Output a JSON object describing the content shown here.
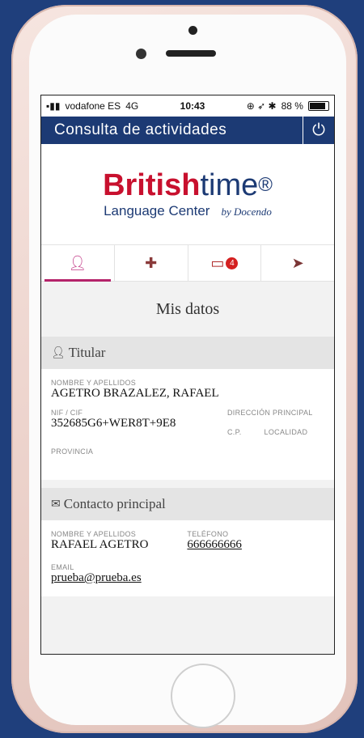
{
  "status_bar": {
    "carrier": "vodafone ES",
    "network": "4G",
    "time": "10:43",
    "battery": "88 %"
  },
  "header": {
    "title": "Consulta de actividades",
    "power_icon": "power-icon"
  },
  "logo": {
    "british": "British",
    "time": "time",
    "registered": "®",
    "subtitle": "Language Center",
    "by": "by Docendo"
  },
  "tabs": [
    {
      "icon": "user-icon",
      "active": true
    },
    {
      "icon": "puzzle-icon",
      "active": false
    },
    {
      "icon": "card-icon",
      "active": false,
      "badge": "4"
    },
    {
      "icon": "send-icon",
      "active": false
    }
  ],
  "main": {
    "section_title": "Mis datos",
    "titular": {
      "heading": "Titular",
      "name_label": "NOMBRE Y APELLIDOS",
      "name_value": "AGETRO BRAZALEZ, RAFAEL",
      "nif_label": "NIF / CIF",
      "nif_value": "352685G6+WER8T+9E8",
      "address_label": "DIRECCIÓN PRINCIPAL",
      "cp_label": "C.P.",
      "locality_label": "LOCALIDAD",
      "province_label": "PROVINCIA"
    },
    "contacto": {
      "heading": "Contacto principal",
      "name_label": "NOMBRE Y APELLIDOS",
      "name_value": "RAFAEL AGETRO",
      "phone_label": "TELÉFONO",
      "phone_value": "666666666",
      "email_label": "EMAIL",
      "email_value": "prueba@prueba.es"
    }
  },
  "colors": {
    "header_bg": "#1c3a74",
    "accent": "#b5236a",
    "brand_red": "#c8102e"
  }
}
